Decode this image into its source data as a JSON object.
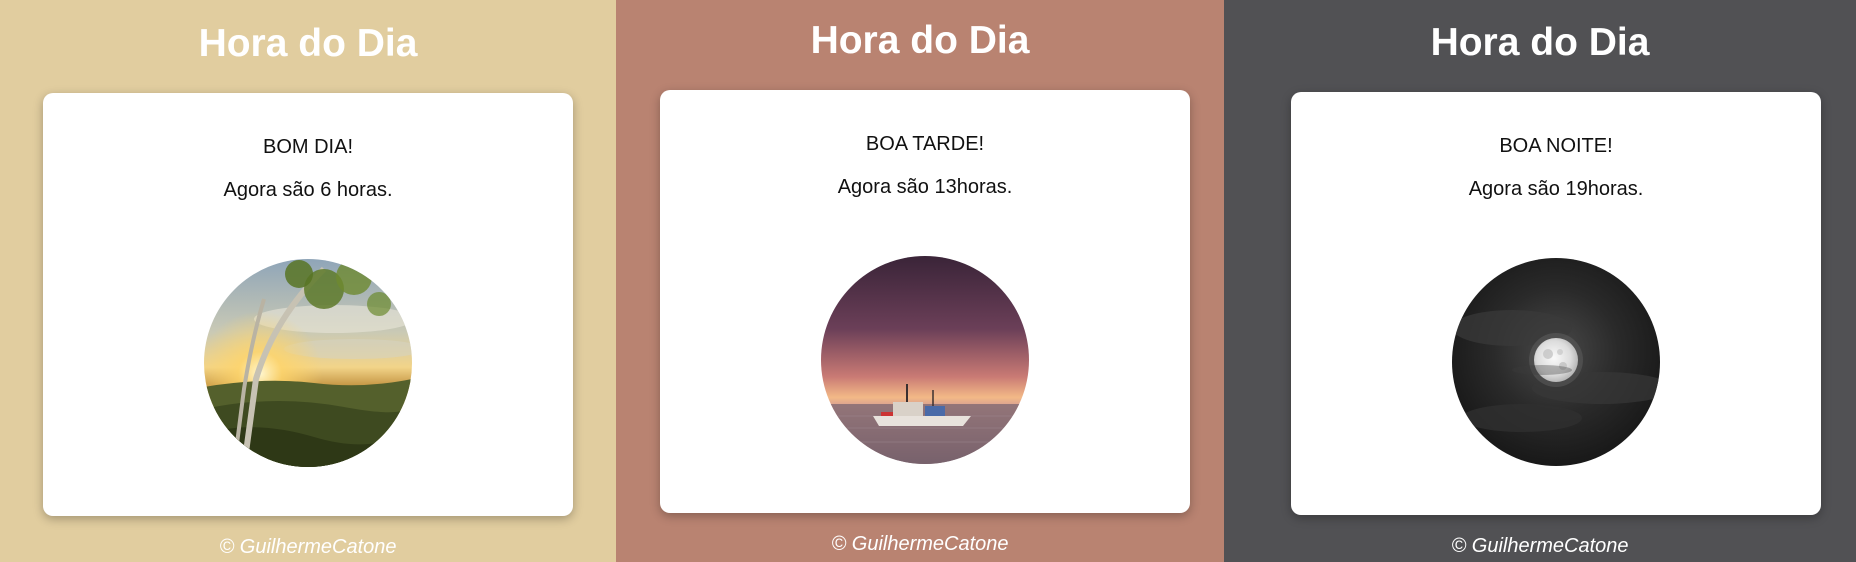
{
  "panels": [
    {
      "id": "morning",
      "background": "#e1cd9f",
      "title": "Hora do Dia",
      "greeting": "BOM DIA!",
      "time_text": "Agora são 6 horas.",
      "image_alt": "sunrise over forested hills",
      "footer": "© GuilhermeCatone"
    },
    {
      "id": "afternoon",
      "background": "#b98371",
      "title": "Hora do Dia",
      "greeting": "BOA TARDE!",
      "time_text": "Agora são 13horas.",
      "image_alt": "fishing boat at sunset on the sea",
      "footer": "© GuilhermeCatone"
    },
    {
      "id": "night",
      "background": "#515154",
      "title": "Hora do Dia",
      "greeting": "BOA NOITE!",
      "time_text": "Agora são 19horas.",
      "image_alt": "full moon behind dark clouds",
      "footer": "© GuilhermeCatone"
    }
  ]
}
